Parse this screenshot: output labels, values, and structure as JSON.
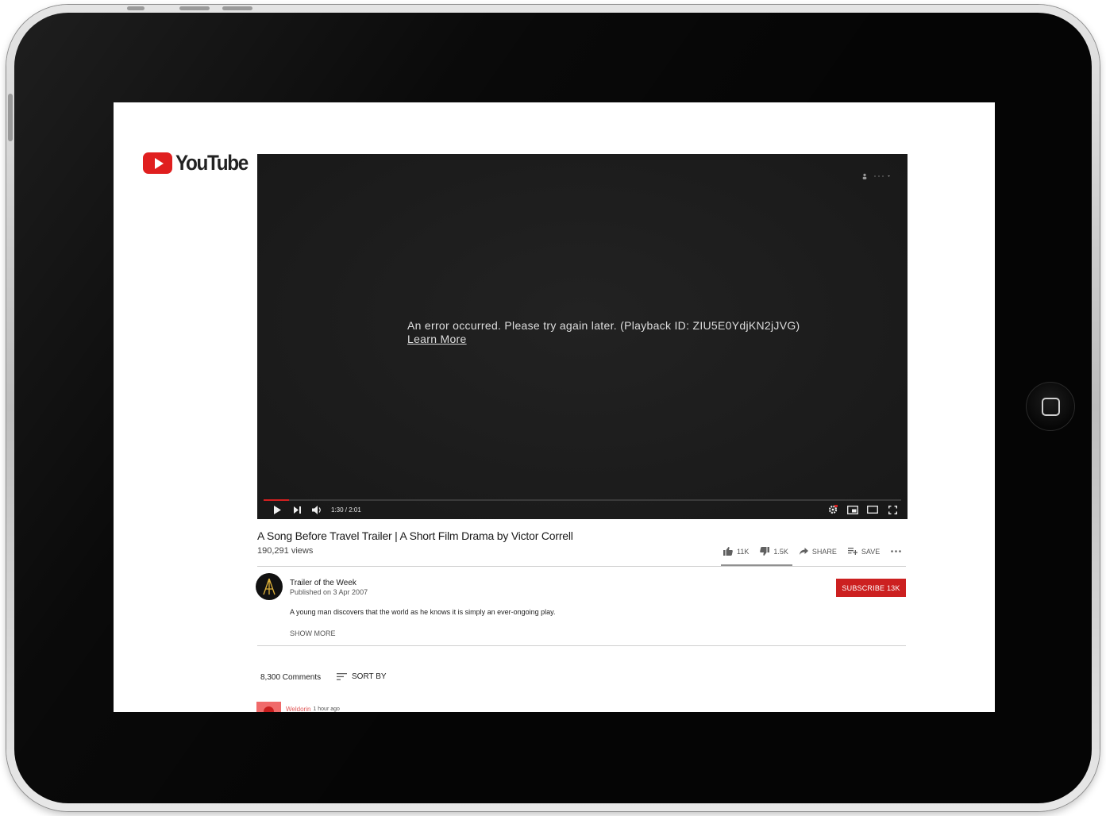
{
  "brand": {
    "logo_text": "YouTube",
    "accent": "#e01f1f"
  },
  "player": {
    "error_message": "An error occurred. Please try again later. (Playback ID: ZIU5E0YdjKN2jJVG)",
    "learn_more": "Learn More",
    "time_display": "1:30 / 2:01",
    "progress": 0.04
  },
  "video": {
    "title": "A Song Before Travel Trailer | A Short Film Drama by Victor Correll",
    "views": "190,291 views"
  },
  "actions": {
    "likes": "11K",
    "dislikes": "1.5K",
    "share": "SHARE",
    "save": "SAVE"
  },
  "channel": {
    "name": "Trailer of the Week",
    "published": "Published on 3 Apr 2007",
    "subscribe_label": "SUBSCRIBE",
    "subscriber_count": "13K"
  },
  "description": {
    "text": "A young man discovers that the world as he knows it is simply an ever-ongoing play.",
    "show_more": "SHOW MORE"
  },
  "comments": {
    "count": "8,300 Comments",
    "sort_label": "SORT BY",
    "first_comment": {
      "author": "Weldorin",
      "time": "1 hour ago"
    }
  }
}
